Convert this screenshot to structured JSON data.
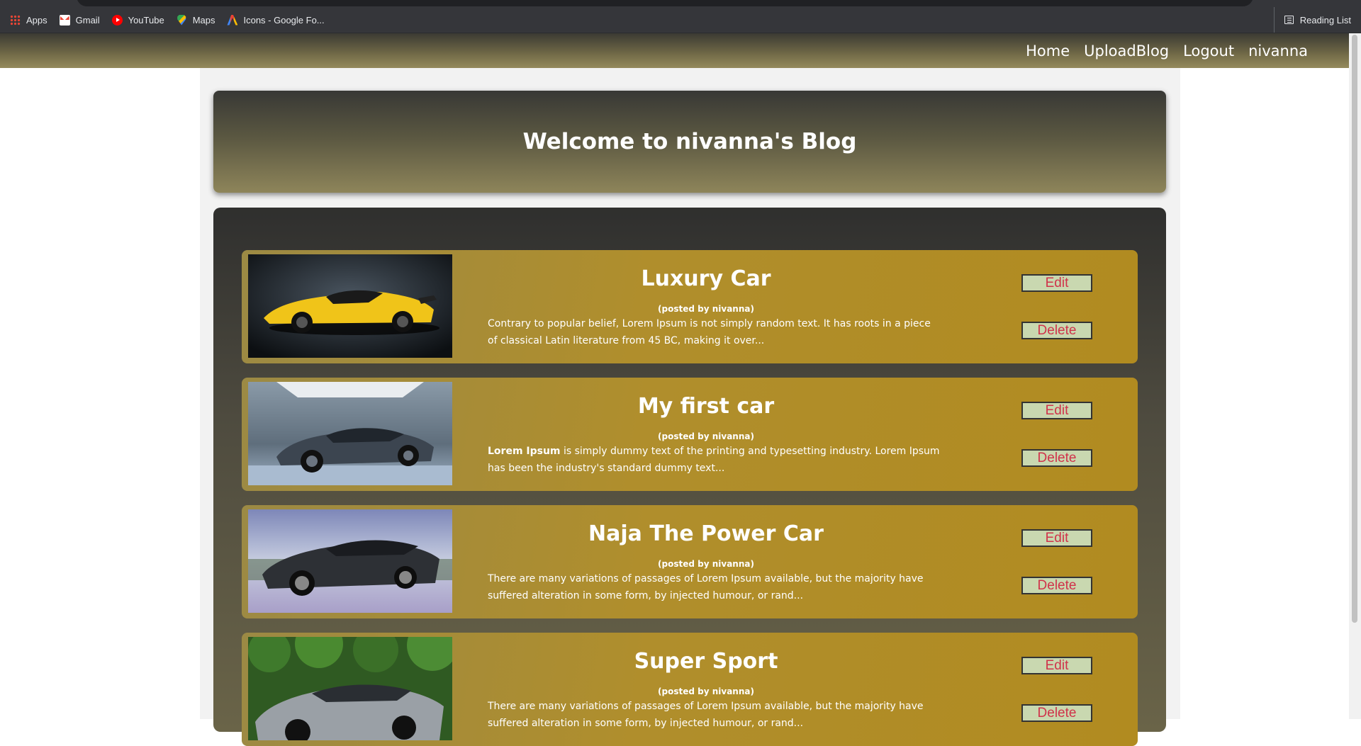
{
  "bookmarks": [
    {
      "label": "Apps",
      "icon": "apps-icon"
    },
    {
      "label": "Gmail",
      "icon": "gmail-icon"
    },
    {
      "label": "YouTube",
      "icon": "youtube-icon"
    },
    {
      "label": "Maps",
      "icon": "maps-icon"
    },
    {
      "label": "Icons - Google Fo...",
      "icon": "google-fonts-icon"
    }
  ],
  "reading_list": "Reading List",
  "nav": {
    "home": "Home",
    "upload": "UploadBlog",
    "logout": "Logout",
    "user": "nivanna"
  },
  "hero": {
    "title": "Welcome to nivanna's Blog"
  },
  "posts": [
    {
      "title": "Luxury Car",
      "byline": "(posted by nivanna)",
      "excerpt_bold": "",
      "excerpt": "Contrary to popular belief, Lorem Ipsum is not simply random text. It has roots in a piece of classical Latin literature from 45 BC, making it over...",
      "edit": "Edit",
      "delete": "Delete"
    },
    {
      "title": "My first car",
      "byline": "(posted by nivanna)",
      "excerpt_bold": "Lorem Ipsum",
      "excerpt": " is simply dummy text of the printing and typesetting industry. Lorem Ipsum has been the industry's standard dummy text...",
      "edit": "Edit",
      "delete": "Delete"
    },
    {
      "title": "Naja The Power Car",
      "byline": "(posted by nivanna)",
      "excerpt_bold": "",
      "excerpt": "There are many variations of passages of Lorem Ipsum available, but the majority have suffered alteration in some form, by injected humour, or rand...",
      "edit": "Edit",
      "delete": "Delete"
    },
    {
      "title": "Super Sport",
      "byline": "(posted by nivanna)",
      "excerpt_bold": "",
      "excerpt": "There are many variations of passages of Lorem Ipsum available, but the majority have suffered alteration in some form, by injected humour, or rand...",
      "edit": "Edit",
      "delete": "Delete"
    }
  ],
  "colors": {
    "card_gold": "#b08e2c",
    "button_bg": "#c9d8b0",
    "button_text": "#d0324a"
  }
}
